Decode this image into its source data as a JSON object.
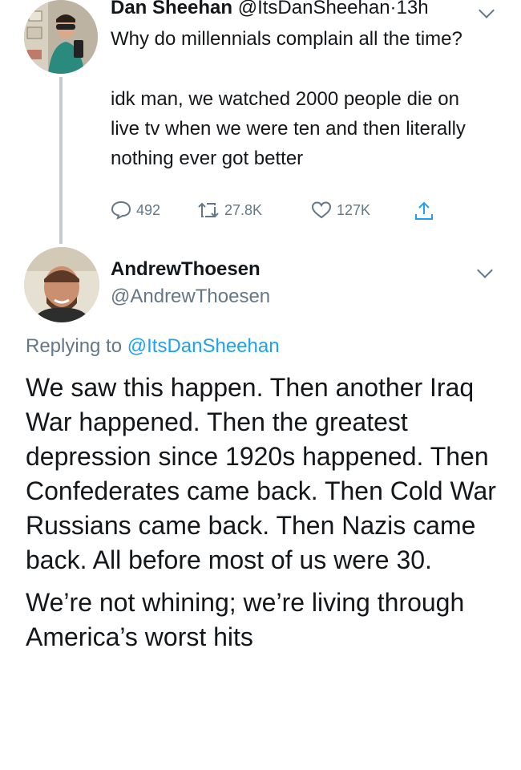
{
  "tweet1": {
    "name": "Dan Sheehan",
    "handle": "@ItsDanSheehan",
    "separator": "·",
    "time": "13h",
    "text1": "Why do millennials complain all the time?",
    "text2": "idk man, we watched 2000 people die on live tv when we were ten and then literally nothing ever got better",
    "replies": "492",
    "retweets": "27.8K",
    "likes": "127K"
  },
  "tweet2": {
    "name": "AndrewThoesen",
    "handle": "@AndrewThoesen",
    "replying_prefix": "Replying to",
    "replying_to": "@ItsDanSheehan",
    "paragraph1": "We saw this happen. Then another Iraq War happened. Then the greatest depression since 1920s happened. Then Confederates came back. Then Cold War Russians came back. Then Nazis came back. All before most of us were 30.",
    "paragraph2": "We’re not whining; we’re living through America’s worst hits"
  },
  "colors": {
    "text": "#14171a",
    "secondary": "#657786",
    "link": "#1da1f2"
  },
  "icons": [
    "reply-icon",
    "retweet-icon",
    "like-icon",
    "share-icon",
    "chevron-down-icon"
  ]
}
